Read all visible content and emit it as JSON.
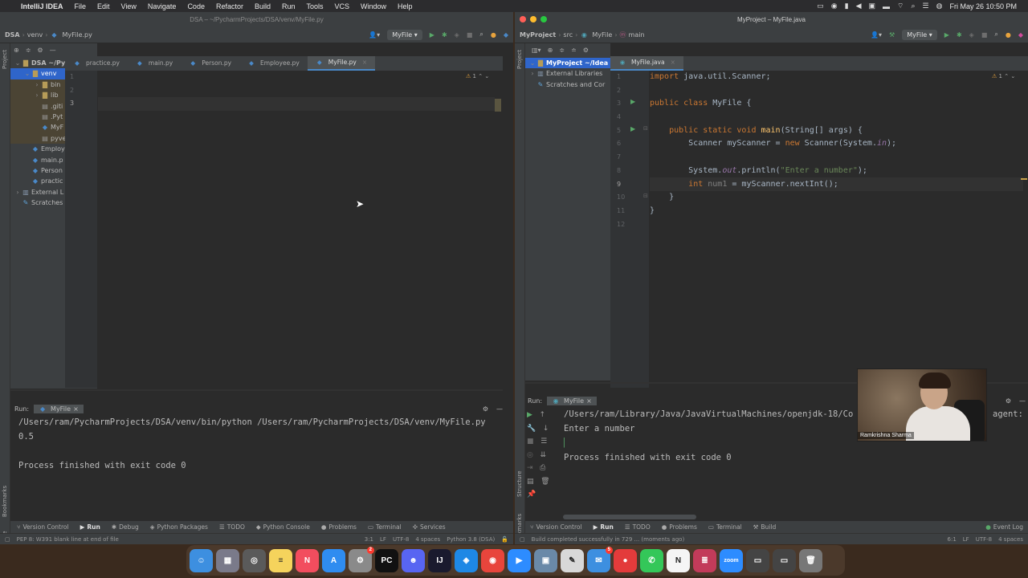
{
  "menubar": {
    "app": "IntelliJ IDEA",
    "items": [
      "File",
      "Edit",
      "View",
      "Navigate",
      "Code",
      "Refactor",
      "Build",
      "Run",
      "Tools",
      "VCS",
      "Window",
      "Help"
    ],
    "clock": "Fri May 26  10:50 PM"
  },
  "left": {
    "title": "DSA – ~/PycharmProjects/DSA/venv/MyFile.py",
    "breadcrumb": [
      "DSA",
      "venv",
      "MyFile.py"
    ],
    "run_config": "MyFile",
    "tabs": [
      "practice.py",
      "main.py",
      "Person.py",
      "Employee.py",
      "MyFile.py"
    ],
    "active_tab": "MyFile.py",
    "tree": [
      {
        "label": "DSA ~/Py",
        "kind": "folder",
        "depth": 0,
        "open": true
      },
      {
        "label": "venv",
        "kind": "folder",
        "depth": 1,
        "open": true,
        "selected": true
      },
      {
        "label": "bin",
        "kind": "folder",
        "depth": 2,
        "open": false,
        "hl": true
      },
      {
        "label": "lib",
        "kind": "folder",
        "depth": 2,
        "open": false,
        "hl": true
      },
      {
        "label": ".giti",
        "kind": "txt",
        "depth": 2,
        "hl": true
      },
      {
        "label": ".Pyt",
        "kind": "txt",
        "depth": 2,
        "hl": true
      },
      {
        "label": "MyF",
        "kind": "py",
        "depth": 2,
        "hl": true
      },
      {
        "label": "pyve",
        "kind": "txt",
        "depth": 2,
        "hl": true
      },
      {
        "label": "Employ",
        "kind": "py",
        "depth": 1
      },
      {
        "label": "main.p",
        "kind": "py",
        "depth": 1
      },
      {
        "label": "Person",
        "kind": "py",
        "depth": 1
      },
      {
        "label": "practic",
        "kind": "py",
        "depth": 1
      },
      {
        "label": "External L",
        "kind": "lib",
        "depth": 0,
        "open": false
      },
      {
        "label": "Scratches",
        "kind": "scr",
        "depth": 0
      }
    ],
    "line_numbers": [
      "1",
      "2",
      "3"
    ],
    "warning_count": "1",
    "run_label": "Run:",
    "run_tab": "MyFile",
    "output": [
      "/Users/ram/PycharmProjects/DSA/venv/bin/python /Users/ram/PycharmProjects/DSA/venv/MyFile.py",
      "0.5",
      "",
      "Process finished with exit code 0"
    ],
    "bottom_tabs": [
      "Version Control",
      "Run",
      "Debug",
      "Python Packages",
      "TODO",
      "Python Console",
      "Problems",
      "Terminal",
      "Services"
    ],
    "status_left": "PEP 8: W391 blank line at end of file",
    "status_right": [
      "3:1",
      "LF",
      "UTF-8",
      "4 spaces",
      "Python 3.8 (DSA)"
    ]
  },
  "right": {
    "title": "MyProject – MyFile.java",
    "breadcrumb": [
      "MyProject",
      "src",
      "MyFile",
      "main"
    ],
    "run_config": "MyFile",
    "active_tab": "MyFile.java",
    "tree": [
      {
        "label": "MyProject ~/Idea",
        "kind": "folder",
        "depth": 0,
        "open": true,
        "selected": true
      },
      {
        "label": "External Libraries",
        "kind": "lib",
        "depth": 0,
        "open": false
      },
      {
        "label": "Scratches and Cor",
        "kind": "scr",
        "depth": 0
      }
    ],
    "line_numbers": [
      "1",
      "2",
      "3",
      "4",
      "5",
      "6",
      "7",
      "8",
      "9",
      "10",
      "11",
      "12"
    ],
    "warning_count": "1",
    "run_label": "Run:",
    "run_tab": "MyFile",
    "output": [
      "/Users/ram/Library/Java/JavaVirtualMachines/openjdk-18/Co",
      "Enter a number",
      "",
      "Process finished with exit code 0"
    ],
    "output_suffix": "agent:",
    "bottom_tabs": [
      "Version Control",
      "Run",
      "TODO",
      "Problems",
      "Terminal",
      "Build"
    ],
    "event_log": "Event Log",
    "status_left": "Build completed successfully in 729 ... (moments ago)",
    "status_right": [
      "6:1",
      "LF",
      "UTF-8",
      "4 spaces"
    ]
  },
  "webcam": {
    "name": "Ramkrishna Sharma"
  },
  "dock": [
    {
      "name": "Finder",
      "color": "#3d8fe0",
      "glyph": "☺"
    },
    {
      "name": "Launchpad",
      "color": "#7a7a8a",
      "glyph": "▦"
    },
    {
      "name": "Screenshot",
      "color": "#5a5a5a",
      "glyph": "◎"
    },
    {
      "name": "Notes",
      "color": "#f5d35c",
      "glyph": "≡"
    },
    {
      "name": "News",
      "color": "#f24d5e",
      "glyph": "N"
    },
    {
      "name": "App Store",
      "color": "#2f8cf0",
      "glyph": "A"
    },
    {
      "name": "System Preferences",
      "color": "#8a8a8a",
      "glyph": "⚙",
      "badge": "2"
    },
    {
      "name": "PyCharm",
      "color": "#111111",
      "glyph": "PC"
    },
    {
      "name": "Discord",
      "color": "#5865f2",
      "glyph": "☻"
    },
    {
      "name": "IntelliJ IDEA",
      "color": "#1a1a2e",
      "glyph": "IJ"
    },
    {
      "name": "Safari",
      "color": "#1e88e5",
      "glyph": "◈"
    },
    {
      "name": "Chrome",
      "color": "#e8453c",
      "glyph": "◉"
    },
    {
      "name": "Zoom",
      "color": "#2d8cff",
      "glyph": "▶"
    },
    {
      "name": "Preview",
      "color": "#6a89a8",
      "glyph": "▣"
    },
    {
      "name": "TextEdit",
      "color": "#d8d8d8",
      "glyph": "✎"
    },
    {
      "name": "Mail",
      "color": "#3d8fe0",
      "glyph": "✉",
      "badge": "5"
    },
    {
      "name": "Voice Memos",
      "color": "#e33b3b",
      "glyph": "●"
    },
    {
      "name": "Messages",
      "color": "#34c759",
      "glyph": "✆"
    },
    {
      "name": "Notion",
      "color": "#f5f5f5",
      "glyph": "N"
    },
    {
      "name": "MyProject",
      "color": "#c23b5a",
      "glyph": "≣"
    },
    {
      "name": "zoom",
      "color": "#2d8cff",
      "glyph": "zoom"
    },
    {
      "name": "Window",
      "color": "#444444",
      "glyph": "▭"
    },
    {
      "name": "Window 2",
      "color": "#444444",
      "glyph": "▭"
    },
    {
      "name": "Trash",
      "color": "#777777",
      "glyph": "🗑"
    }
  ]
}
